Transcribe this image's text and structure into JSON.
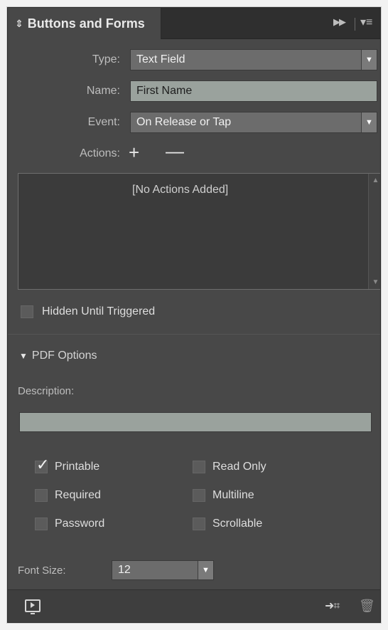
{
  "panel": {
    "tab_title": "Buttons and Forms",
    "tab_updown": "⇕"
  },
  "form": {
    "type_label": "Type:",
    "type_value": "Text Field",
    "name_label": "Name:",
    "name_value": "First Name",
    "event_label": "Event:",
    "event_value": "On Release or Tap",
    "actions_label": "Actions:",
    "add_action": "+",
    "remove_action": "—",
    "no_actions": "[No Actions Added]",
    "hidden_until_triggered": "Hidden Until Triggered"
  },
  "pdf_options": {
    "title": "PDF Options",
    "description_label": "Description:",
    "description_value": "",
    "checkboxes": [
      {
        "label": "Printable",
        "checked": true
      },
      {
        "label": "Read Only",
        "checked": false
      },
      {
        "label": "Required",
        "checked": false
      },
      {
        "label": "Multiline",
        "checked": false
      },
      {
        "label": "Password",
        "checked": false
      },
      {
        "label": "Scrollable",
        "checked": false
      }
    ],
    "font_size_label": "Font Size:",
    "font_size_value": "12"
  },
  "icons": {
    "panel_menu": "hamburger-menu-icon",
    "expand": "double-chevron-right-icon",
    "preview": "preview-spread-icon",
    "convert": "convert-to-object-icon",
    "trash": "trash-icon"
  }
}
